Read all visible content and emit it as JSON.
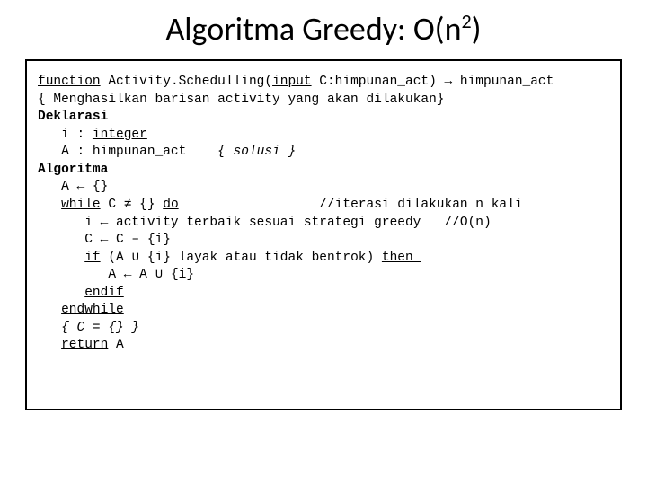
{
  "title_prefix": "Algoritma Greedy: O(n",
  "title_sup": "2",
  "title_suffix": ")",
  "code": {
    "kw_function": "function",
    "fn_name": " Activity.Schedulling(",
    "kw_input": "input",
    "sig_rest": " C:himpunan_act) → himpunan_act",
    "comment_desc": "{ Menghasilkan barisan activity yang akan dilakukan}",
    "kw_deklarasi": "Deklarasi",
    "decl_i_pre": "   i : ",
    "kw_integer": "integer",
    "decl_A": "   A : himpunan_act    ",
    "comment_solusi": "{ solusi }",
    "kw_algoritma": "Algoritma",
    "line_A_init": "   A ← {}",
    "kw_while_pre": "   ",
    "kw_while": "while",
    "while_cond": " C ≠ {} ",
    "kw_do": "do",
    "while_comment": "                  //iterasi dilakukan n kali",
    "line_i": "      i ← activity terbaik sesuai strategi greedy   //O(n)",
    "line_c": "      C ← C – {i}",
    "if_pre": "      ",
    "kw_if": "if",
    "if_cond": " (A ∪ {i} layak atau tidak bentrok) ",
    "kw_then": "then ",
    "line_assign": "         A ← A ∪ {i}",
    "endif_pre": "      ",
    "kw_endif": "endif",
    "endwhile_pre": "   ",
    "kw_endwhile": "endwhile",
    "comment_c_pre": "   ",
    "comment_c": "{ C = {} }",
    "return_pre": "   ",
    "kw_return": "return",
    "return_val": " A"
  }
}
